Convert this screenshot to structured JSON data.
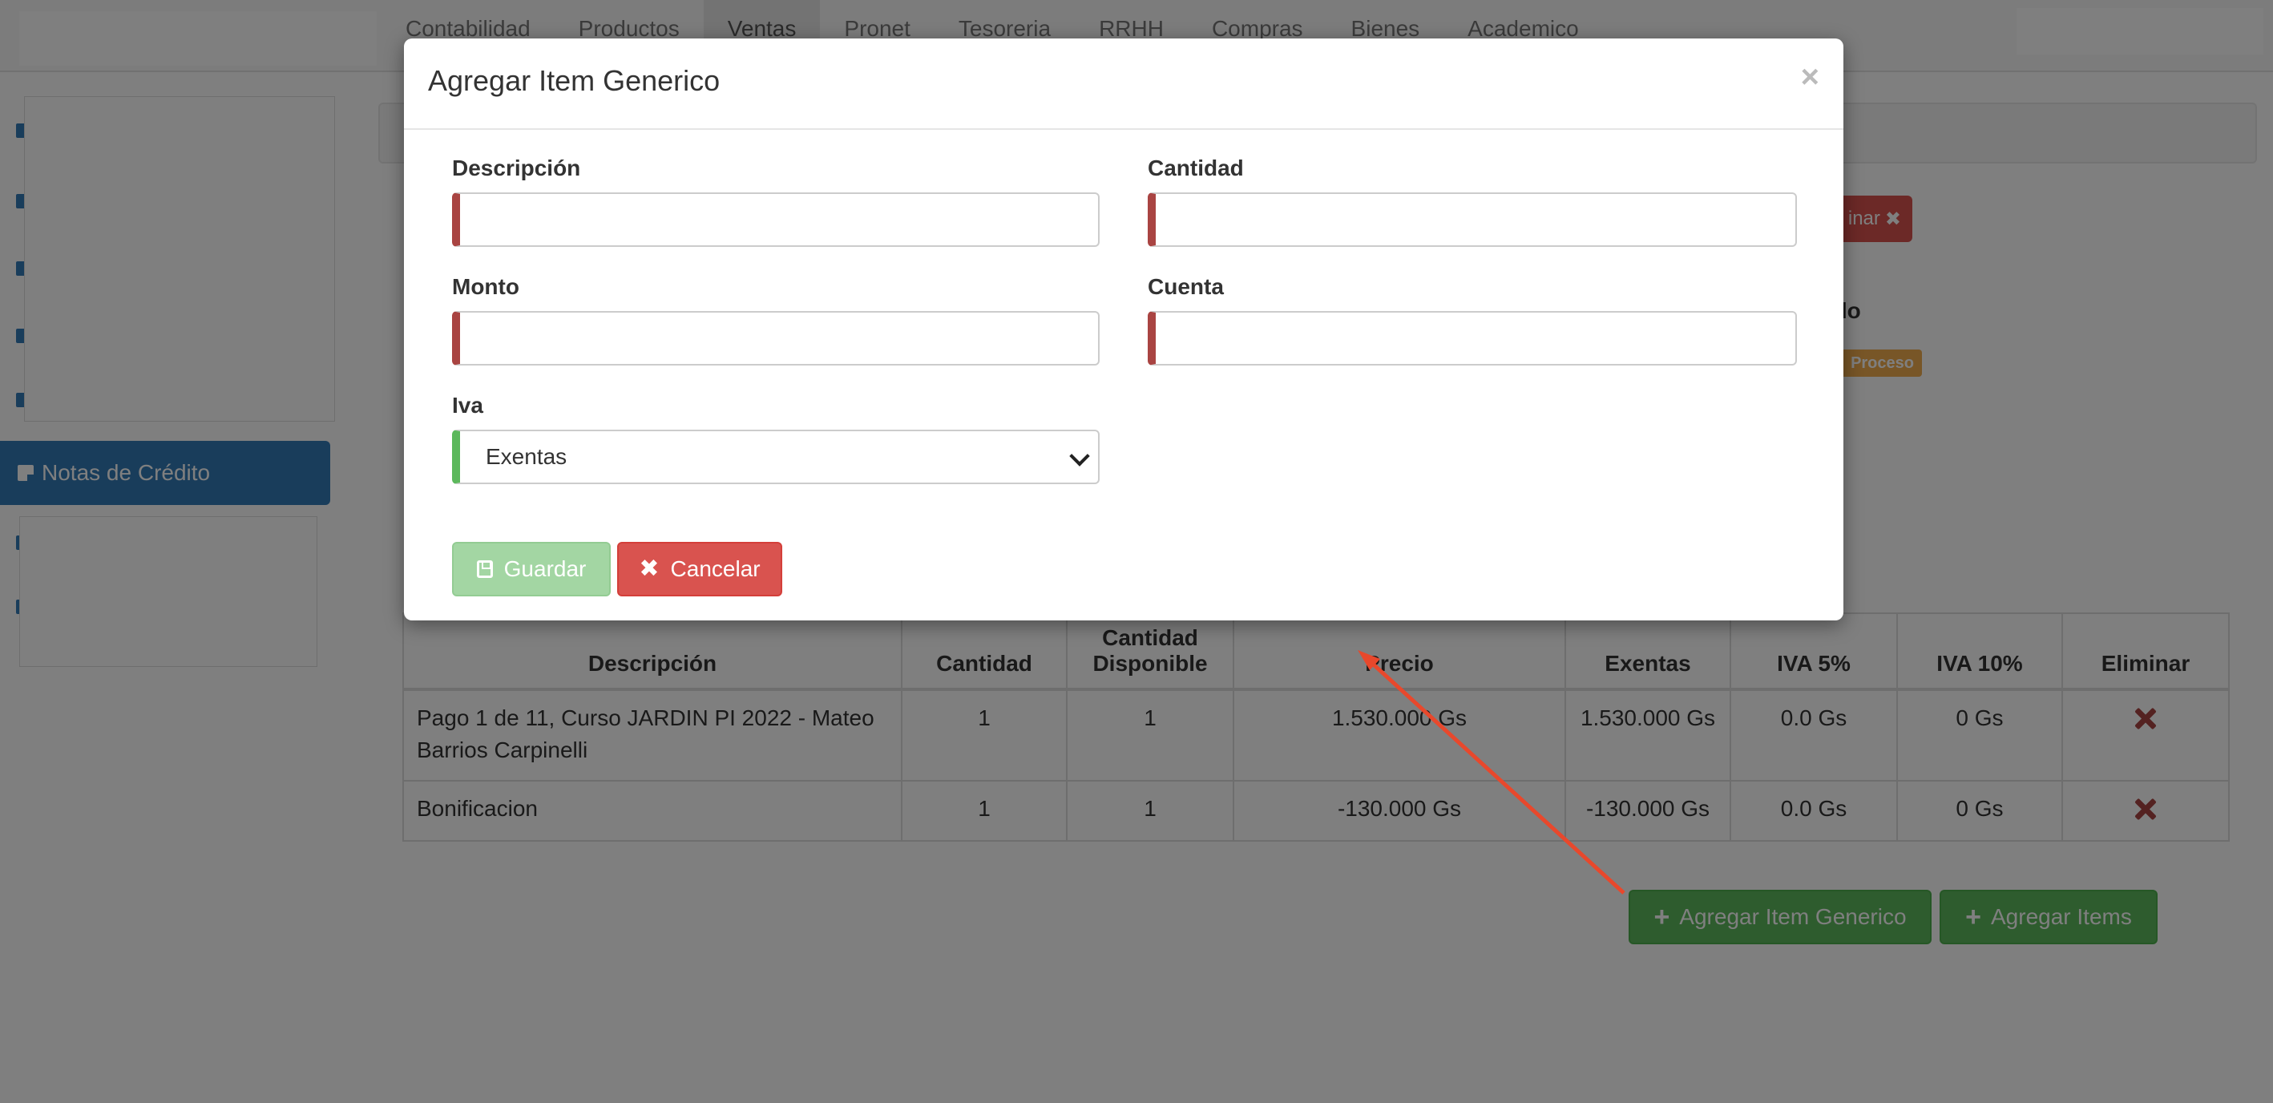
{
  "nav": {
    "items": [
      "Contabilidad",
      "Productos",
      "Ventas",
      "Pronet",
      "Tesoreria",
      "RRHH",
      "Compras",
      "Bienes",
      "Academico"
    ],
    "active": "Ventas"
  },
  "sidebar": {
    "active_item": "Notas de Crédito"
  },
  "background": {
    "eliminar_fragment": "inar",
    "estado_fragment": "ado",
    "status_badge_fragment": "Proceso"
  },
  "table": {
    "headers": {
      "descripcion": "Descripción",
      "cantidad": "Cantidad",
      "cantidad_disponible_1": "Cantidad",
      "cantidad_disponible_2": "Disponible",
      "precio": "Precio",
      "exentas": "Exentas",
      "iva5": "IVA 5%",
      "iva10": "IVA 10%",
      "eliminar": "Eliminar"
    },
    "rows": [
      {
        "descripcion": "Pago 1 de 11, Curso JARDIN PI 2022 - Mateo Barrios Carpinelli",
        "cantidad": "1",
        "disponible": "1",
        "precio": "1.530.000 Gs",
        "exentas": "1.530.000 Gs",
        "iva5": "0.0 Gs",
        "iva10": "0 Gs"
      },
      {
        "descripcion": "Bonificacion",
        "cantidad": "1",
        "disponible": "1",
        "precio": "-130.000 Gs",
        "exentas": "-130.000 Gs",
        "iva5": "0.0 Gs",
        "iva10": "0 Gs"
      }
    ]
  },
  "buttons": {
    "agregar_item_generico": "Agregar Item Generico",
    "agregar_items": "Agregar Items"
  },
  "modal": {
    "title": "Agregar Item Generico",
    "close": "×",
    "fields": {
      "descripcion_label": "Descripción",
      "cantidad_label": "Cantidad",
      "monto_label": "Monto",
      "cuenta_label": "Cuenta",
      "iva_label": "Iva",
      "iva_selected": "Exentas"
    },
    "guardar": "Guardar",
    "cancelar": "Cancelar"
  },
  "colors": {
    "primary": "#337ab7",
    "success": "#5cb85c",
    "danger": "#d9534f",
    "warning": "#f0ad4e",
    "annotation_arrow": "#e8482c"
  }
}
